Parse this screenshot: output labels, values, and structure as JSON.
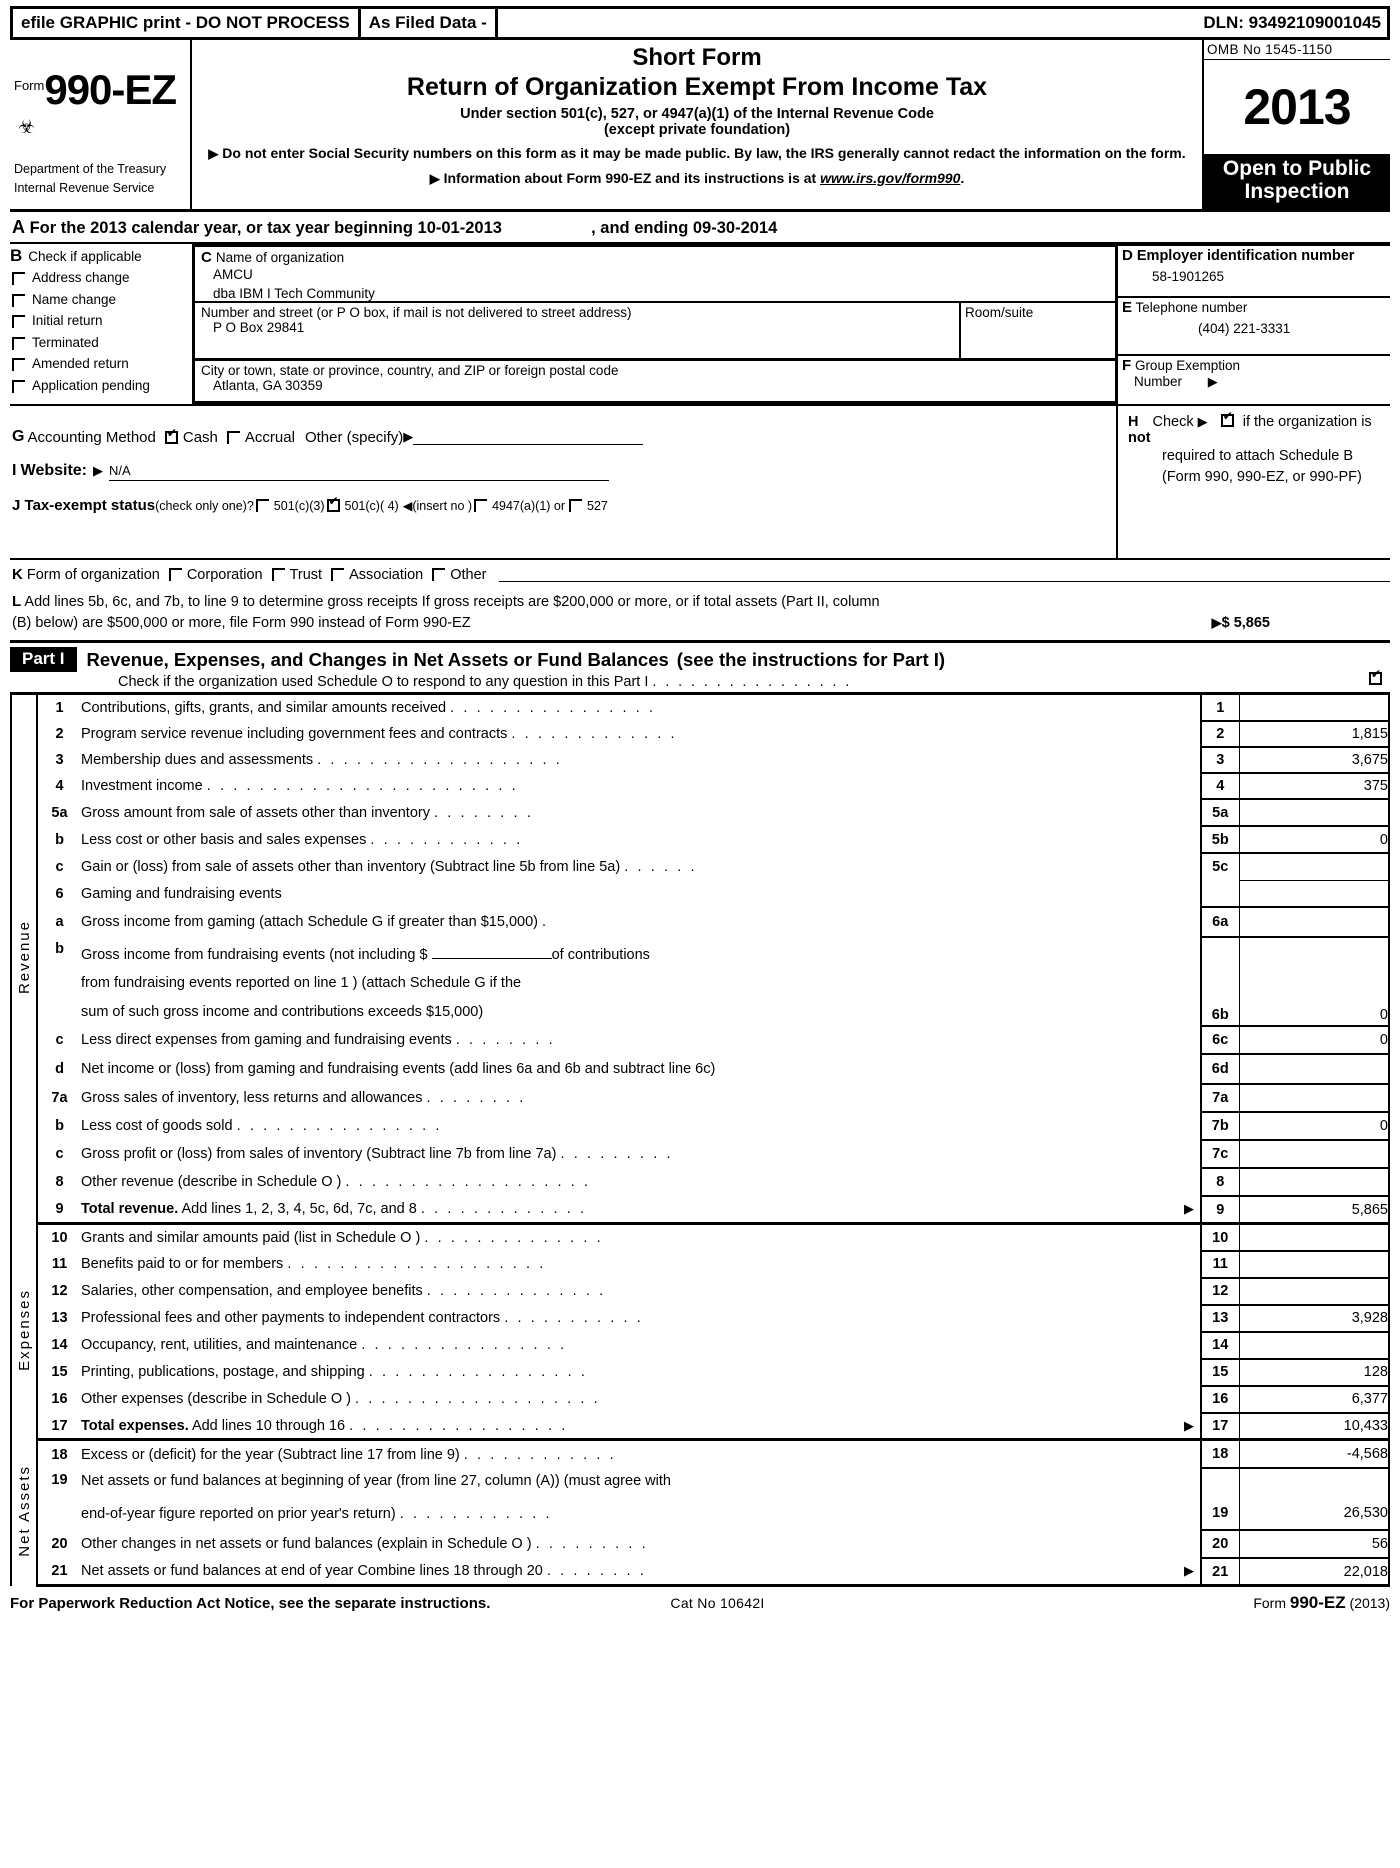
{
  "efile_header": {
    "left": "efile GRAPHIC print - DO NOT PROCESS",
    "middle": "As Filed Data -",
    "dln": "DLN: 93492109001045"
  },
  "form_header": {
    "form_label": "Form",
    "form_number": "990-EZ",
    "department": "Department of the Treasury",
    "agency": "Internal Revenue Service",
    "short_form": "Short Form",
    "main_title": "Return of Organization Exempt From Income Tax",
    "subtitle_1": "Under section 501(c), 527, or 4947(a)(1) of the Internal Revenue Code",
    "subtitle_2": "(except private foundation)",
    "bullet_1": "Do not enter Social Security numbers on this form as it may be made public. By law, the IRS generally cannot redact the information on the form.",
    "bullet_2_pre": "Information about Form 990-EZ and its instructions is at ",
    "bullet_2_url": "www.irs.gov/form990",
    "bullet_2_post": ".",
    "omb": "OMB No 1545-1150",
    "tax_year": "2013",
    "open_to_public": "Open to Public",
    "inspection": "Inspection"
  },
  "line_a": {
    "letter": "A",
    "text_pre": "For the 2013 calendar year, or tax year beginning",
    "begin_date": "10-01-2013",
    "text_mid": ", and ending",
    "end_date": "09-30-2014"
  },
  "section_b": {
    "letter": "B",
    "title": "Check if applicable",
    "options": [
      {
        "label": "Address change",
        "checked": false
      },
      {
        "label": "Name change",
        "checked": false
      },
      {
        "label": "Initial return",
        "checked": false
      },
      {
        "label": "Terminated",
        "checked": false
      },
      {
        "label": "Amended return",
        "checked": false
      },
      {
        "label": "Application pending",
        "checked": false
      }
    ]
  },
  "section_c": {
    "letter": "C",
    "name_header": "Name of organization",
    "org_name": "AMCU",
    "org_dba": "dba IBM I Tech Community",
    "street_header": "Number and street (or P  O  box, if mail is not delivered to street address)",
    "street_value": "P O Box 29841",
    "room_header": "Room/suite",
    "room_value": "",
    "city_header": "City or town, state or province, country, and ZIP or foreign postal code",
    "city_value": "Atlanta, GA  30359"
  },
  "section_d": {
    "letter": "D",
    "header": "Employer identification number",
    "value": "58-1901265"
  },
  "section_e": {
    "letter": "E",
    "header": "Telephone number",
    "value": "(404) 221-3331"
  },
  "section_f": {
    "letter": "F",
    "header_line1": "Group Exemption",
    "header_line2": "Number",
    "value": ""
  },
  "section_g": {
    "letter": "G",
    "label": "Accounting Method",
    "cash": "Cash",
    "cash_checked": true,
    "accrual": "Accrual",
    "accrual_checked": false,
    "other": "Other (specify)"
  },
  "section_h": {
    "letter": "H",
    "check_label": "Check",
    "checked": true,
    "text_1_pre": "if the organization is ",
    "text_1_bold": "not",
    "text_2": "required to attach Schedule B",
    "text_3": "(Form 990, 990-EZ, or 990-PF)"
  },
  "section_i": {
    "letter": "I",
    "label": "Website:",
    "value": "N/A"
  },
  "section_j": {
    "letter": "J",
    "label": "Tax-exempt status",
    "note": "(check only one)?",
    "options": [
      {
        "label": "501(c)(3)",
        "checked": false
      },
      {
        "label": "501(c)( 4)",
        "checked": true
      },
      {
        "label": "4947(a)(1) or",
        "checked": false
      },
      {
        "label": "527",
        "checked": false
      }
    ],
    "insert_note": "(insert no )"
  },
  "section_k": {
    "letter": "K",
    "label": "Form of organization",
    "options": [
      {
        "label": "Corporation",
        "checked": false
      },
      {
        "label": "Trust",
        "checked": false
      },
      {
        "label": "Association",
        "checked": false
      },
      {
        "label": "Other",
        "checked": false
      }
    ]
  },
  "section_l": {
    "letter": "L",
    "text_line1": "Add lines 5b, 6c, and 7b, to line 9 to determine gross receipts  If gross receipts are $200,000 or more, or if total assets (Part II, column",
    "text_line2": "(B) below) are $500,000 or more, file Form 990 instead of Form 990-EZ",
    "amount": "$ 5,865"
  },
  "part_i": {
    "tag": "Part I",
    "title": "Revenue, Expenses, and Changes in Net Assets or Fund Balances",
    "note": "(see the instructions for Part I)",
    "schedule_o_text": "Check if the organization used Schedule O to respond to any question in this Part I",
    "schedule_o_checked": true,
    "side_captions": {
      "revenue": "Revenue",
      "expenses": "Expenses",
      "net_assets": "Net Assets"
    },
    "lines": [
      {
        "num": "1",
        "text": "Contributions, gifts, grants, and similar amounts received",
        "dots": true,
        "rnum": "1",
        "rval": ""
      },
      {
        "num": "2",
        "text": "Program service revenue including government fees and contracts",
        "dots": true,
        "rnum": "2",
        "rval": "1,815"
      },
      {
        "num": "3",
        "text": "Membership dues and assessments",
        "dots": true,
        "rnum": "3",
        "rval": "3,675"
      },
      {
        "num": "4",
        "text": "Investment income",
        "dots": true,
        "rnum": "4",
        "rval": "375"
      },
      {
        "num": "5a",
        "text": "Gross amount from sale of assets other than inventory",
        "dots": true,
        "mnum": "5a",
        "mval": ""
      },
      {
        "num": "b",
        "text": "Less  cost or other basis and sales expenses",
        "dots": true,
        "mnum": "5b",
        "mval": "0"
      },
      {
        "num": "c",
        "text": "Gain or (loss) from sale of assets other than inventory (Subtract line 5b from line 5a)",
        "dots": true,
        "rnum": "5c",
        "rval": ""
      },
      {
        "num": "6",
        "text": "Gaming and fundraising events",
        "dots": false
      },
      {
        "num": "a",
        "text": "Gross income from gaming (attach Schedule G if greater than $15,000)",
        "dots": true,
        "mnum": "6a",
        "mval": ""
      },
      {
        "num": "b",
        "text": "Gross income from fundraising events (not including $ ________ of contributions from fundraising events reported on line 1) (attach Schedule G if the sum of such gross income and contributions exceeds $15,000)",
        "dots": false,
        "mnum": "6b",
        "mval": "0"
      },
      {
        "num": "c",
        "text": "Less  direct expenses from gaming and fundraising events",
        "dots": true,
        "mnum": "6c",
        "mval": "0"
      },
      {
        "num": "d",
        "text": "Net income or (loss) from gaming and fundraising events (add lines 6a and 6b and subtract line 6c)",
        "dots": false,
        "rnum": "6d",
        "rval": ""
      },
      {
        "num": "7a",
        "text": "Gross sales of inventory, less returns and allowances",
        "dots": true,
        "mnum": "7a",
        "mval": ""
      },
      {
        "num": "b",
        "text": "Less  cost of goods sold",
        "dots": true,
        "mnum": "7b",
        "mval": "0"
      },
      {
        "num": "c",
        "text": "Gross profit or (loss) from sales of inventory (Subtract line 7b from line 7a)",
        "dots": true,
        "rnum": "7c",
        "rval": ""
      },
      {
        "num": "8",
        "text": "Other revenue (describe in Schedule O )",
        "dots": true,
        "rnum": "8",
        "rval": ""
      },
      {
        "num": "9",
        "text_bold": "Total revenue.",
        "text": " Add lines 1, 2, 3, 4, 5c, 6d, 7c, and 8",
        "dots": true,
        "arrow": true,
        "rnum": "9",
        "rval": "5,865"
      },
      {
        "num": "10",
        "text": "Grants and similar amounts paid (list in Schedule O )",
        "dots": true,
        "rnum": "10",
        "rval": ""
      },
      {
        "num": "11",
        "text": "Benefits paid to or for members",
        "dots": true,
        "rnum": "11",
        "rval": ""
      },
      {
        "num": "12",
        "text": "Salaries, other compensation, and employee benefits",
        "dots": true,
        "rnum": "12",
        "rval": ""
      },
      {
        "num": "13",
        "text": "Professional fees and other payments to independent contractors",
        "dots": true,
        "rnum": "13",
        "rval": "3,928"
      },
      {
        "num": "14",
        "text": "Occupancy, rent, utilities, and maintenance",
        "dots": true,
        "rnum": "14",
        "rval": ""
      },
      {
        "num": "15",
        "text": "Printing, publications, postage, and shipping",
        "dots": true,
        "rnum": "15",
        "rval": "128"
      },
      {
        "num": "16",
        "text": "Other expenses (describe in Schedule O )",
        "dots": true,
        "rnum": "16",
        "rval": "6,377"
      },
      {
        "num": "17",
        "text_bold": "Total expenses.",
        "text": " Add lines 10 through 16",
        "dots": true,
        "arrow": true,
        "rnum": "17",
        "rval": "10,433"
      },
      {
        "num": "18",
        "text": "Excess or (deficit) for the year (Subtract line 17 from line 9)",
        "dots": true,
        "rnum": "18",
        "rval": "-4,568"
      },
      {
        "num": "19",
        "text": "Net assets or fund balances at beginning of year (from line 27, column (A)) (must agree with end-of-year figure reported on prior year's return)",
        "dots": true,
        "rnum": "19",
        "rval": "26,530"
      },
      {
        "num": "20",
        "text": "Other changes in net assets or fund balances (explain in Schedule O )",
        "dots": true,
        "rnum": "20",
        "rval": "56"
      },
      {
        "num": "21",
        "text": "Net assets or fund balances at end of year  Combine lines 18 through 20",
        "dots": true,
        "arrow": true,
        "rnum": "21",
        "rval": "22,018"
      }
    ]
  },
  "footer": {
    "paperwork": "For Paperwork Reduction Act Notice, see the separate instructions.",
    "cat_no": "Cat No  10642I",
    "form_pre": "Form ",
    "form_num": "990-EZ",
    "form_year": " (2013)"
  }
}
